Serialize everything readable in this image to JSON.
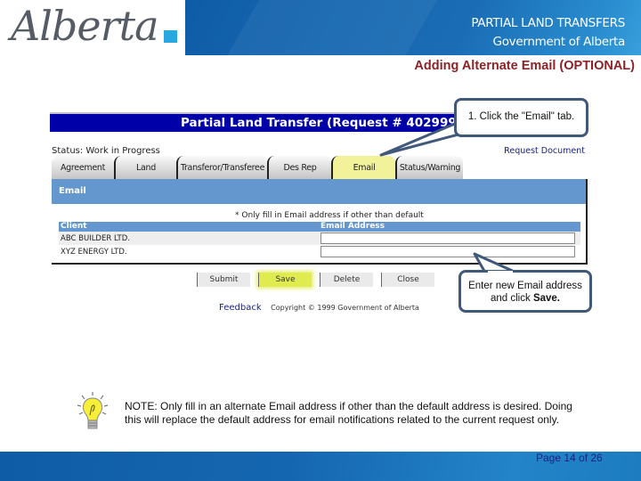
{
  "header": {
    "logo_text": "Alberta",
    "banner_line1": "PARTIAL LAND TRANSFERS",
    "banner_line2": "Government of Alberta",
    "slide_subtitle": "Adding Alternate Email (OPTIONAL)"
  },
  "app": {
    "title": "Partial Land Transfer (Request # 402999",
    "status_label": "Status:",
    "status_value": "Work in Progress",
    "request_document_link": "Request Document",
    "tabs": [
      {
        "label": "Agreement",
        "active": false
      },
      {
        "label": "Land",
        "active": false
      },
      {
        "label": "Transferor/Transferee",
        "active": false
      },
      {
        "label": "Des Rep",
        "active": false
      },
      {
        "label": "Email",
        "active": true
      },
      {
        "label": "Status/Warning",
        "active": false
      }
    ],
    "panel_title": "Email",
    "panel_note": "* Only fill in Email address if other than default",
    "grid": {
      "headers": [
        "Client",
        "Email Address"
      ],
      "rows": [
        {
          "client": "ABC BUILDER LTD.",
          "email": ""
        },
        {
          "client": "XYZ ENERGY LTD.",
          "email": ""
        }
      ]
    },
    "buttons": {
      "submit": "Submit",
      "save": "Save",
      "delete": "Delete",
      "close": "Close"
    },
    "feedback_link": "Feedback",
    "copyright": "Copyright © 1999 Government of Alberta"
  },
  "callouts": {
    "step1": "1. Click the \"Email\" tab.",
    "step2_line1": "Enter new Email address",
    "step2_line2_prefix": "and click ",
    "step2_line2_bold": "Save."
  },
  "note": {
    "icon": "lightbulb-icon",
    "text": "NOTE: Only fill in an alternate Email address if other than the default address is desired. Doing this will replace the default address for email notifications related to the current request only."
  },
  "footer": {
    "page_label": "Page 14 of 26"
  },
  "colors": {
    "banner_blue": "#1566b0",
    "subtitle_red": "#8b2326",
    "app_title_blue": "#0000a8",
    "panel_blue": "#6397cd",
    "active_tab_yellow": "#f2f29a",
    "callout_border": "#40587a"
  }
}
